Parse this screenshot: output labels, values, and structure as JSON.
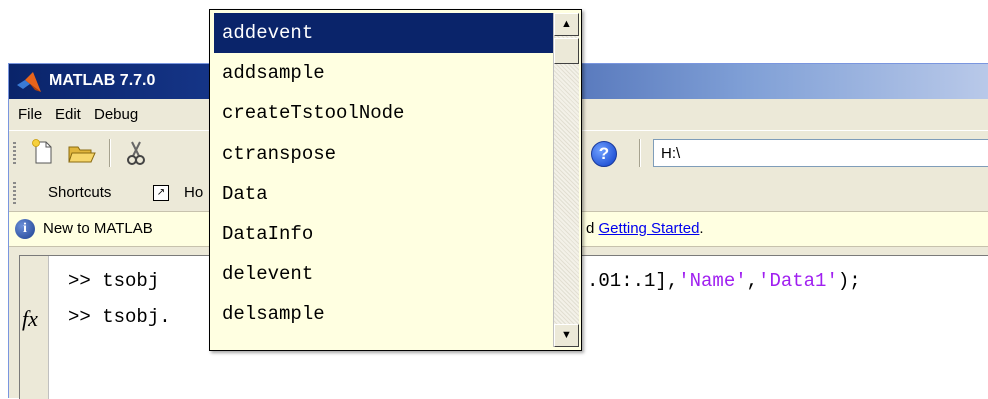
{
  "window": {
    "title": "MATLAB 7.7.0"
  },
  "menubar": {
    "items": [
      "File",
      "Edit",
      "Debug"
    ]
  },
  "toolbar": {
    "current_folder": "H:\\",
    "help_glyph": "?"
  },
  "shortcuts": {
    "label": "Shortcuts",
    "howto_label": "Ho",
    "howto_glyph": "↗"
  },
  "infobar": {
    "icon_glyph": "i",
    "text": "New to MATLAB",
    "tail_prefix": "d ",
    "link_text": "Getting Started",
    "tail_suffix": "."
  },
  "command_window": {
    "fx_label": "fx",
    "line1_prefix": ">> tsobj ",
    "line1_tail_plain": ".01:.1],",
    "line1_str1": "'Name'",
    "line1_comma": ",",
    "line1_str2": "'Data1'",
    "line1_end": ");",
    "line2": ">> tsobj.",
    "string_color": "#a020f0"
  },
  "autocomplete": {
    "selected_index": 0,
    "items": [
      "addevent",
      "addsample",
      "createTstoolNode",
      "ctranspose",
      "Data",
      "DataInfo",
      "delevent",
      "delsample"
    ],
    "scroll_up_glyph": "▲",
    "scroll_down_glyph": "▼"
  }
}
